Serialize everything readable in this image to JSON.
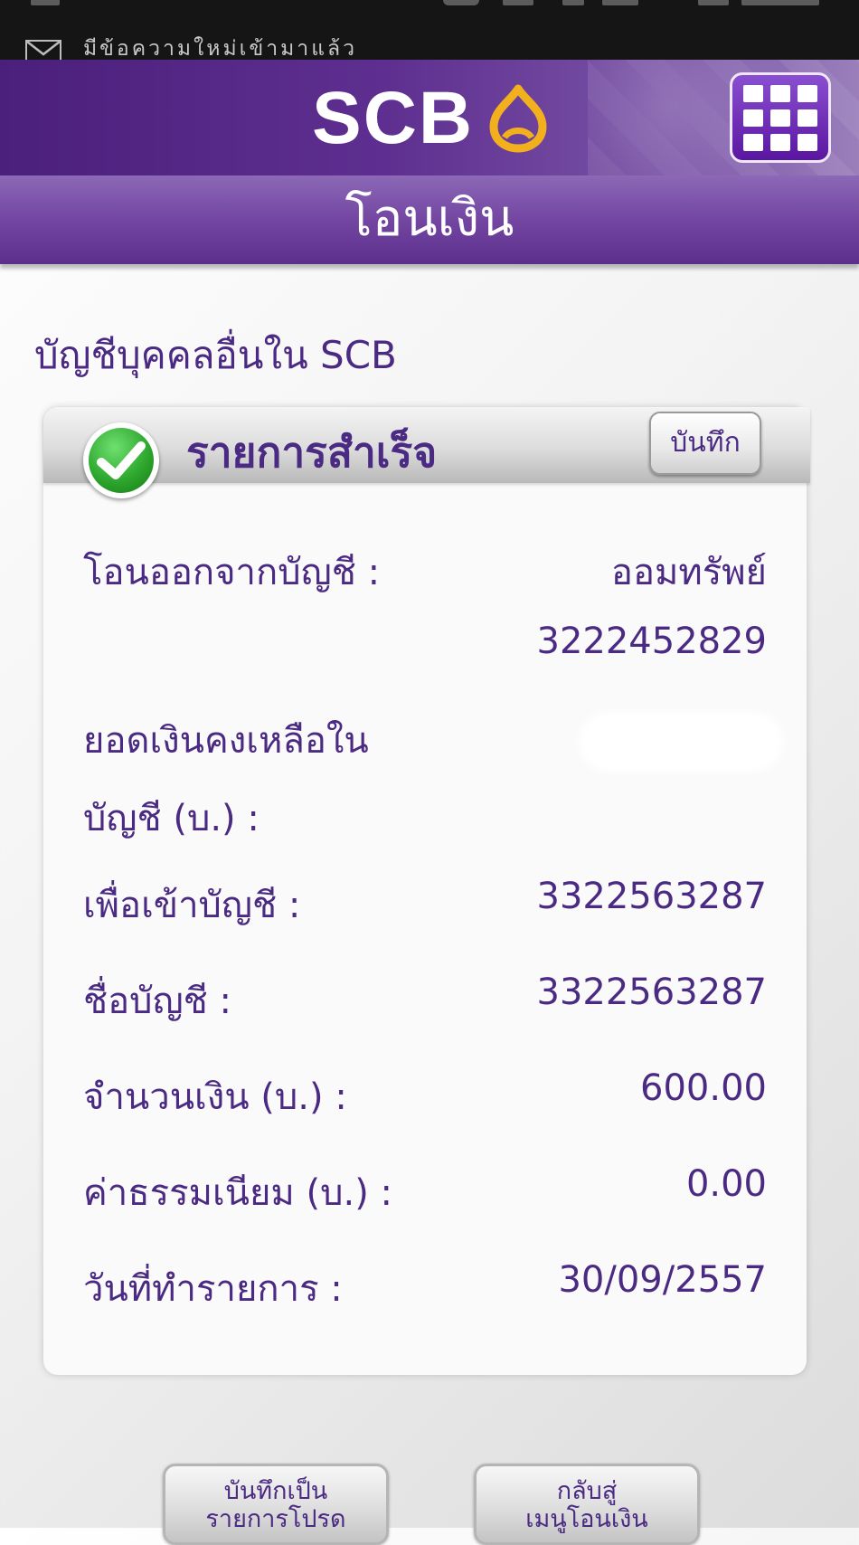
{
  "status_bar": {
    "notification_text": "มีข้อความใหม่เข้ามาแล้ว",
    "notification_icon": "mail-icon"
  },
  "header": {
    "logo_text": "SCB",
    "logo_mark": "scb-lotus-icon",
    "menu_icon": "grid-menu-icon",
    "title": "โอนเงิน"
  },
  "page": {
    "section_title": "บัญชีบุคคลอื่นใน SCB"
  },
  "result": {
    "status_text": "รายการสำเร็จ",
    "status_icon": "check-circle-icon",
    "save_label": "บันทึก",
    "rows": {
      "from_account_label": "โอนออกจากบัญชี :",
      "from_account_type": "ออมทรัพย์",
      "from_account_number": "3222452829",
      "balance_label_line1": "ยอดเงินคงเหลือใน",
      "balance_label_line2": "บัญชี (บ.) :",
      "to_account_label": "เพื่อเข้าบัญชี :",
      "to_account_value": "3322563287",
      "account_name_label": "ชื่อบัญชี :",
      "account_name_value": "3322563287",
      "amount_label": "จำนวนเงิน (บ.) :",
      "amount_value": "600.00",
      "fee_label": "ค่าธรรมเนียม (บ.) :",
      "fee_value": "0.00",
      "date_label": "วันที่ทำรายการ :",
      "date_value": "30/09/2557"
    }
  },
  "footer": {
    "save_favorite_line1": "บันทึกเป็น",
    "save_favorite_line2": "รายการโปรด",
    "back_line1": "กลับสู่",
    "back_line2": "เมนูโอนเงิน"
  },
  "colors": {
    "brand_purple": "#4b1f7c",
    "text_purple": "#4a2a82",
    "logo_gold": "#f2b01e",
    "success_green": "#2ea82e"
  }
}
